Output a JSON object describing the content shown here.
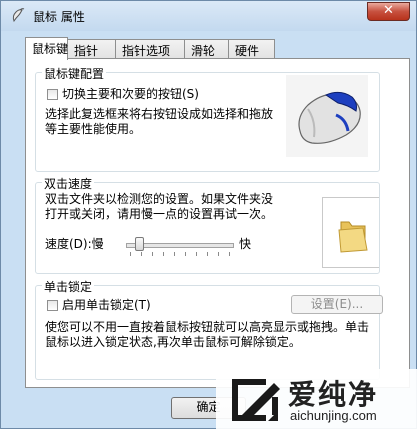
{
  "window": {
    "title": "鼠标 属性",
    "close_glyph": "✕"
  },
  "tabs": [
    {
      "label": "鼠标键",
      "active": true
    },
    {
      "label": "指针",
      "active": false
    },
    {
      "label": "指针选项",
      "active": false
    },
    {
      "label": "滑轮",
      "active": false
    },
    {
      "label": "硬件",
      "active": false
    }
  ],
  "button_config": {
    "legend": "鼠标键配置",
    "swap_checkbox_label": "切换主要和次要的按钮(S)",
    "swap_checked": false,
    "description_line1": "选择此复选框来将右按钮设成如选择和拖放",
    "description_line2": "等主要性能使用。"
  },
  "double_click": {
    "legend": "双击速度",
    "description_line1": "双击文件夹以检测您的设置。如果文件夹没",
    "description_line2": "打开或关闭，请用慢一点的设置再试一次。",
    "speed_label": "速度(D):慢",
    "fast_label": "快",
    "speed_value_fraction": 0.12
  },
  "click_lock": {
    "legend": "单击锁定",
    "checkbox_label": "启用单击锁定(T)",
    "checked": false,
    "settings_button": "设置(E)...",
    "description_line1": "使您可以不用一直按着鼠标按钮就可以高亮显示或拖拽。单击",
    "description_line2": "鼠标以进入锁定状态,再次单击鼠标可解除锁定。"
  },
  "footer": {
    "ok_button": "确定"
  },
  "watermark": {
    "brand": "爱纯净",
    "url": "aichunjing.com"
  },
  "colors": {
    "window_frame": "#c9dff3",
    "close_button": "#c7513f",
    "mouse_accent": "#1d3fbf"
  }
}
